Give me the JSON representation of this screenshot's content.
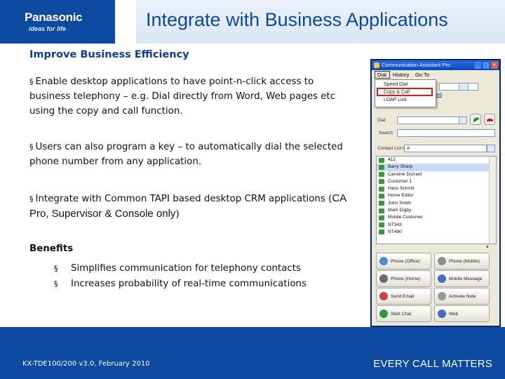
{
  "header": {
    "logo_text": "Panasonic",
    "logo_tagline": "ideas for life",
    "title": "Integrate with Business Applications"
  },
  "content": {
    "subtitle": "Improve Business Efficiency",
    "bullet_marker": "§",
    "paragraphs": [
      {
        "text": "Enable desktop applications to have point-n-click access to business telephony – e.g. Dial directly from Word, Web pages etc using the copy and call function."
      },
      {
        "text": "Users can also program a key – to automatically dial the selected phone number from any application."
      },
      {
        "text_before": "Integrate with Common TAPI based desktop CRM applications (",
        "text_alt": "CA Pro, Supervisor & Console only",
        "text_after": ")"
      }
    ],
    "benefits_title": "Benefits",
    "benefits": [
      "Simplifies communication for telephony contacts",
      "Increases probability of real-time communications"
    ]
  },
  "screenshot": {
    "window_title": "Communication Assistant Pro",
    "menu": [
      "Dial",
      "History",
      "Go To"
    ],
    "dropdown_items": [
      "Speed Dial",
      "Copy & Call",
      "LDAP Link"
    ],
    "dial_label": "Dial",
    "search_label": "Search",
    "group_label": "Contact List Group",
    "group_value": "A",
    "contacts": [
      {
        "name": "412",
        "selected": false
      },
      {
        "name": "Barry Sharp",
        "selected": true
      },
      {
        "name": "Caroline Durrant",
        "selected": false
      },
      {
        "name": "Customer 1",
        "selected": false
      },
      {
        "name": "Hans Schmit",
        "selected": false
      },
      {
        "name": "Home Editor",
        "selected": false
      },
      {
        "name": "John Smith",
        "selected": false
      },
      {
        "name": "Mark Digby",
        "selected": false
      },
      {
        "name": "Mobile Customer",
        "selected": false
      },
      {
        "name": "NT343",
        "selected": false
      },
      {
        "name": "NT480",
        "selected": false
      }
    ],
    "function_buttons": [
      "Phone (Office)",
      "Phone (Mobile)",
      "Phone (Home)",
      "Mobile Message",
      "Send Email",
      "Activate Note",
      "Start Chat",
      "Web"
    ],
    "highlight_color": "#e01818"
  },
  "footer": {
    "code": "KX-TDE100/200 v3.0, February 2010",
    "slogan": "EVERY CALL MATTERS"
  },
  "colors": {
    "brand_blue": "#0b4aa0",
    "title_blue": "#0b4aa0",
    "subtitle_blue": "#0b3d91"
  }
}
